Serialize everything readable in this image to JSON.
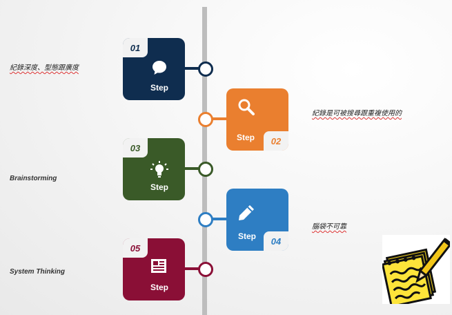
{
  "steps": [
    {
      "number": "01",
      "label": "Step",
      "icon": "speech-bubble-icon",
      "color": "#0f2d4f",
      "note": "紀錄深度、型態跟廣度"
    },
    {
      "number": "02",
      "label": "Step",
      "icon": "magnifier-icon",
      "color": "#ea7f2f",
      "note": "紀錄是可被搜尋跟重複使用的"
    },
    {
      "number": "03",
      "label": "Step",
      "icon": "lightbulb-icon",
      "color": "#3a5a28",
      "note": "Brainstorming"
    },
    {
      "number": "04",
      "label": "Step",
      "icon": "pencil-icon",
      "color": "#2e7ec3",
      "note": "腦袋不可靠"
    },
    {
      "number": "05",
      "label": "Step",
      "icon": "newspaper-icon",
      "color": "#8a0f36",
      "note": "System Thinking"
    }
  ],
  "decoration": {
    "icon": "notepad-pencil-icon"
  }
}
